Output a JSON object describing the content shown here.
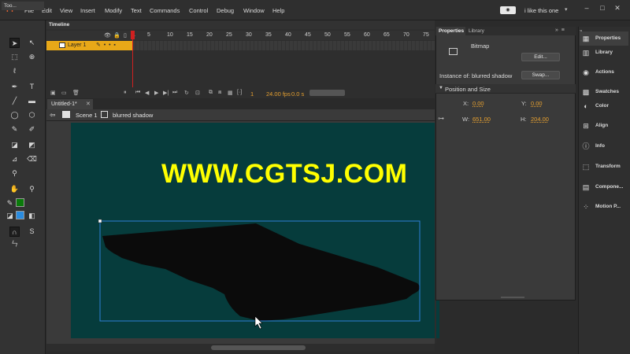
{
  "app": {
    "logo": "Fl",
    "workspace": "i like this one",
    "workspace_icon": "◉"
  },
  "menu": [
    "File",
    "Edit",
    "View",
    "Insert",
    "Modify",
    "Text",
    "Commands",
    "Control",
    "Debug",
    "Window",
    "Help"
  ],
  "window_controls": [
    "minimize-icon",
    "maximize-icon",
    "close-icon"
  ],
  "tools": {
    "header": "Too..."
  },
  "timeline": {
    "tab": "Timeline",
    "frames": [
      "1",
      "5",
      "10",
      "15",
      "20",
      "25",
      "30",
      "35",
      "40",
      "45",
      "50",
      "55",
      "60",
      "65",
      "70",
      "75"
    ],
    "layer": "Layer 1",
    "current_frame": "1",
    "fps": "24.00 fps",
    "time": "0.0 s"
  },
  "document": {
    "tab": "Untitled-1*",
    "scene": "Scene 1",
    "symbol": "blurred shadow"
  },
  "stage": {
    "watermark": "WWW.CGTSJ.COM",
    "background": "#063c3c",
    "selection_color": "#2f7fd6"
  },
  "properties": {
    "tab": "Properties",
    "library_tab": "Library",
    "type": "Bitmap",
    "edit_button": "Edit...",
    "instance_label": "Instance of:",
    "instance_name": "blurred shadow",
    "swap_button": "Swap...",
    "section": "Position and Size",
    "x_label": "X:",
    "x_value": "0.00",
    "y_label": "Y:",
    "y_value": "0.00",
    "w_label": "W:",
    "w_value": "651.00",
    "h_label": "H:",
    "h_value": "204.00"
  },
  "dock": [
    {
      "label": "Properties",
      "icon": "properties-icon",
      "glyph": "▦"
    },
    {
      "label": "Library",
      "icon": "library-icon",
      "glyph": "▥"
    },
    {
      "label": "Actions",
      "icon": "actions-icon",
      "glyph": "◉"
    },
    {
      "label": "Swatches",
      "icon": "swatches-icon",
      "glyph": "▩"
    },
    {
      "label": "Color",
      "icon": "color-icon",
      "glyph": "◐"
    },
    {
      "label": "Align",
      "icon": "align-icon",
      "glyph": "⊞"
    },
    {
      "label": "Info",
      "icon": "info-icon",
      "glyph": "ⓘ"
    },
    {
      "label": "Transform",
      "icon": "transform-icon",
      "glyph": "⬚"
    },
    {
      "label": "Compone...",
      "icon": "components-icon",
      "glyph": "▤"
    },
    {
      "label": "Motion P...",
      "icon": "motion-presets-icon",
      "glyph": "⁘"
    }
  ]
}
